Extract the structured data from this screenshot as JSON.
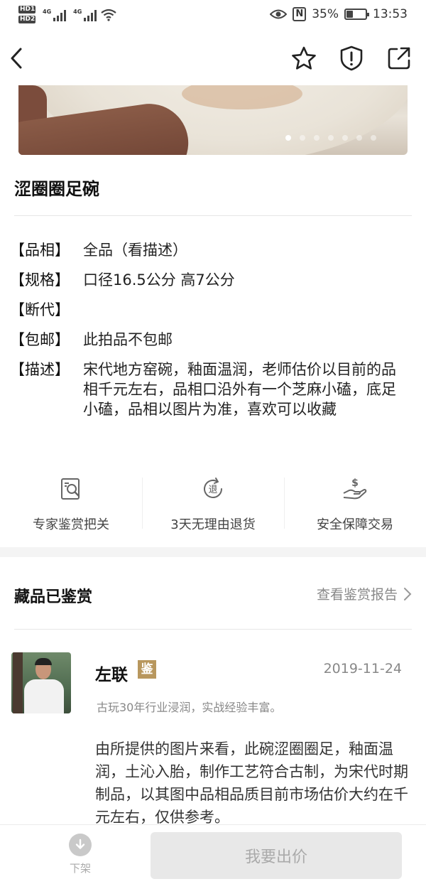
{
  "status_bar": {
    "hd1": "HD1",
    "hd2": "HD2",
    "net1": "4G",
    "net2": "4G",
    "battery_percent": "35%",
    "battery_level": 0.35,
    "time": "13:53"
  },
  "nav": {
    "back_icon": "chevron-left-icon",
    "favorite_icon": "star-icon",
    "report_icon": "shield-exclamation-icon",
    "share_icon": "share-icon"
  },
  "carousel": {
    "dot_count": 7,
    "active_index": 0
  },
  "item": {
    "title": "涩圈圈足碗"
  },
  "attributes": [
    {
      "key": "【品相】",
      "value": "全品（看描述）"
    },
    {
      "key": "【规格】",
      "value": "口径16.5公分 高7公分"
    },
    {
      "key": "【断代】",
      "value": ""
    },
    {
      "key": "【包邮】",
      "value": "此拍品不包邮"
    },
    {
      "key": "【描述】",
      "value": "宋代地方窑碗，釉面温润，老师估价以目前的品相千元左右，品相口沿外有一个芝麻小磕，底足小磕，品相以图片为准，喜欢可以收藏"
    }
  ],
  "guarantees": [
    {
      "icon": "magnifier-document-icon",
      "label": "专家鉴赏把关"
    },
    {
      "icon": "refund-icon",
      "icon_text": "退",
      "label": "3天无理由退货"
    },
    {
      "icon": "hand-dollar-icon",
      "label": "安全保障交易"
    }
  ],
  "appraisal_section": {
    "title": "藏品已鉴赏",
    "report_link": "查看鉴赏报告"
  },
  "expert": {
    "name": "左联",
    "badge": "鉴",
    "date": "2019-11-24",
    "description": "古玩30年行业浸润，实战经验丰富。",
    "appraisal": "由所提供的图片来看，此碗涩圈圈足，釉面温润，土沁入胎，制作工艺符合古制，为宋代时期制品，以其图中品相品质目前市场估价大约在千元左右，仅供参考。"
  },
  "bottom_bar": {
    "delist_label": "下架",
    "bid_button": "我要出价"
  },
  "colors": {
    "badge": "#b8975e",
    "disabled_button_bg": "#e8e8e8",
    "secondary_text": "#888888"
  }
}
